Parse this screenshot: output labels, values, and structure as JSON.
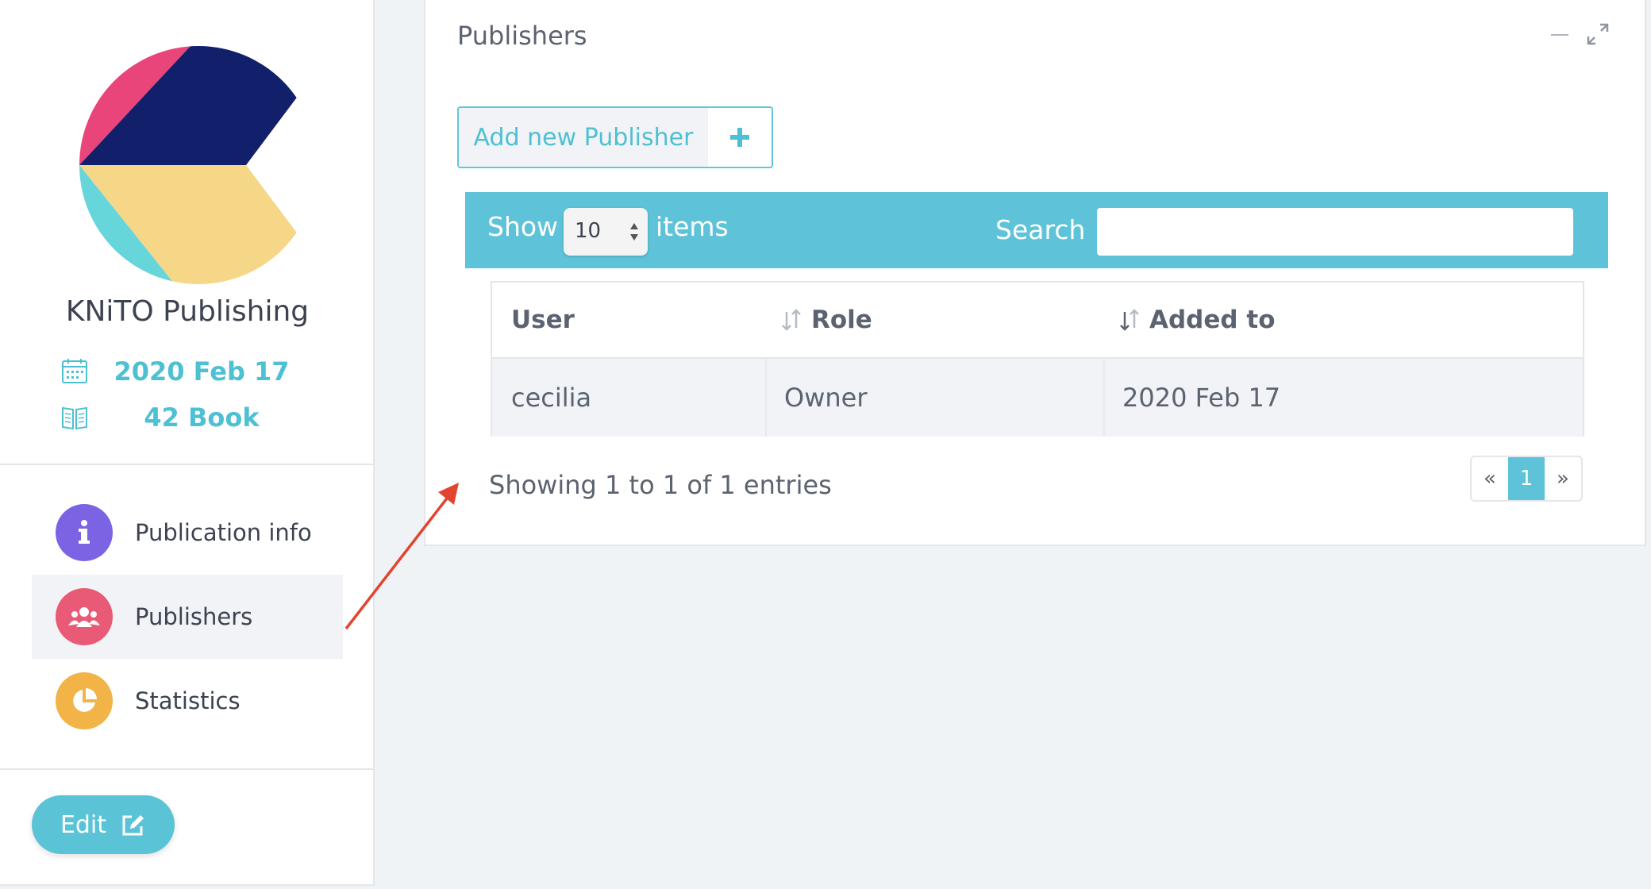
{
  "sidebar": {
    "publisher_name": "KNiTO Publishing",
    "date": "2020 Feb 17",
    "books": "42 Book",
    "nav": [
      {
        "label": "Publication info",
        "color": "#7b63e3"
      },
      {
        "label": "Publishers",
        "color": "#e85a75"
      },
      {
        "label": "Statistics",
        "color": "#f2b347"
      }
    ],
    "edit_label": "Edit"
  },
  "panel": {
    "title": "Publishers",
    "add_button_label": "Add new Publisher",
    "toolbar": {
      "show_label": "Show",
      "page_size": "10",
      "items_label": "items",
      "search_label": "Search",
      "search_value": ""
    },
    "table": {
      "headers": [
        "User",
        "Role",
        "Added to"
      ],
      "rows": [
        [
          "cecilia",
          "Owner",
          "2020 Feb 17"
        ]
      ]
    },
    "info": "Showing 1 to 1 of 1 entries",
    "pagination": {
      "prev": "«",
      "current": "1",
      "next": "»"
    }
  },
  "colors": {
    "accent": "#5ec3d8",
    "annotation_arrow": "#e2452f"
  }
}
